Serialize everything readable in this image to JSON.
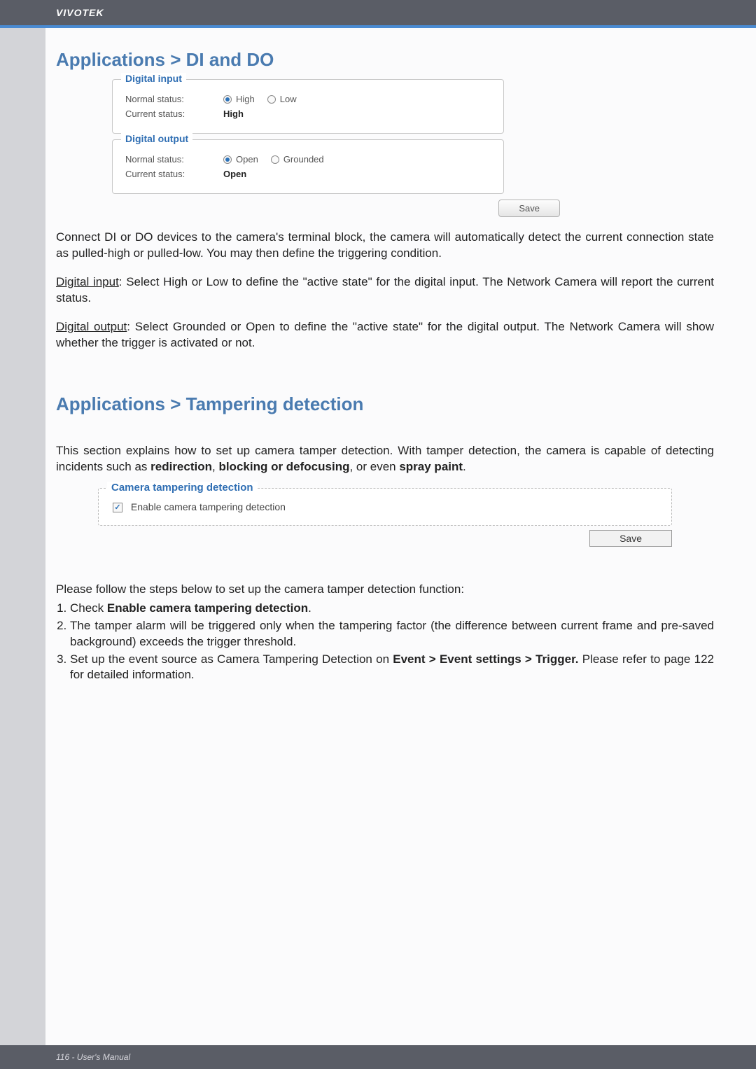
{
  "header": {
    "brand": "VIVOTEK"
  },
  "section1": {
    "title": "Applications > DI and DO",
    "digital_input": {
      "legend": "Digital input",
      "normal_label": "Normal status:",
      "high": "High",
      "low": "Low",
      "current_label": "Current status:",
      "current_value": "High"
    },
    "digital_output": {
      "legend": "Digital output",
      "normal_label": "Normal status:",
      "open": "Open",
      "grounded": "Grounded",
      "current_label": "Current status:",
      "current_value": "Open"
    },
    "save_label": "Save",
    "para1": "Connect DI or DO devices to the camera's terminal block, the camera will automatically detect the current connection state as pulled-high or pulled-low. You may then define the triggering condition.",
    "para2_lead": "Digital input",
    "para2_rest": ": Select High or Low to define the \"active state\" for the digital input. The Network Camera will report the current status.",
    "para3_lead": "Digital output",
    "para3_rest": ": Select Grounded or Open to define the \"active state\" for the digital output. The Network Camera will show whether the trigger is activated or not."
  },
  "section2": {
    "title": "Applications > Tampering detection",
    "intro_prefix": "This section explains how to set up camera tamper detection. With tamper detection, the camera is capable of detecting incidents such as ",
    "intro_bold1": "redirection",
    "intro_mid1": ", ",
    "intro_bold2": "blocking or defocusing",
    "intro_mid2": ", or even ",
    "intro_bold3": "spray paint",
    "intro_suffix": ".",
    "tamper_legend": "Camera tampering detection",
    "tamper_checkbox_label": "Enable camera tampering detection",
    "tamper_save": "Save",
    "steps_intro": "Please follow the steps below to set up the camera tamper detection function:",
    "step1_prefix": "Check ",
    "step1_bold": "Enable camera tampering detection",
    "step1_suffix": ".",
    "step2": "The tamper alarm will be triggered only when the tampering factor (the difference between current frame and pre-saved background) exceeds the trigger threshold.",
    "step3_prefix": "Set up the event source as Camera Tampering Detection on ",
    "step3_bold": "Event > Event settings > Trigger.",
    "step3_suffix": " Please refer to page 122 for detailed information."
  },
  "footer": {
    "text": "116 - User's Manual"
  }
}
